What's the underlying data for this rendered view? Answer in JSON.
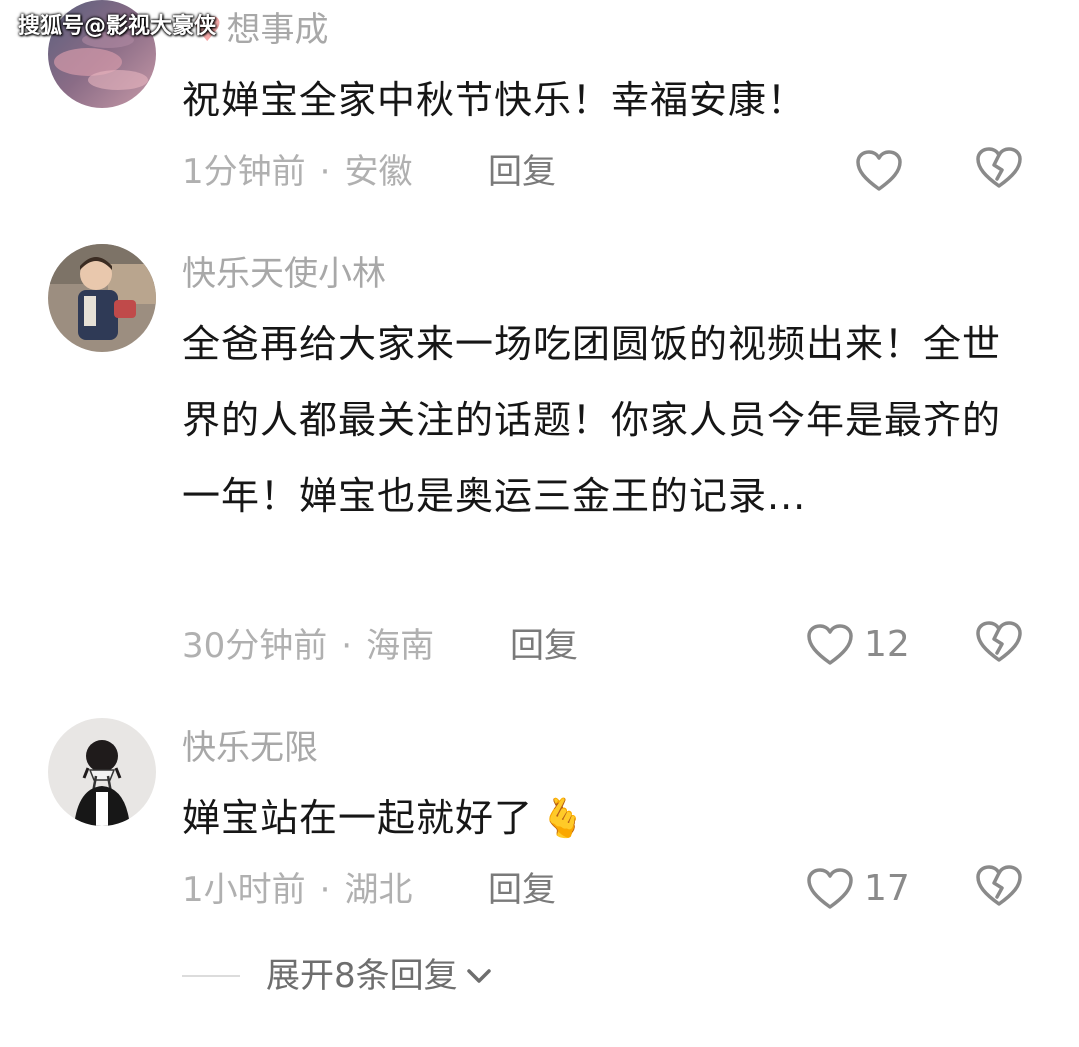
{
  "watermark": "搜狐号@影视大豪侠",
  "comments": [
    {
      "username": "想事成",
      "content": "祝婵宝全家中秋节快乐！幸福安康！",
      "time": "1分钟前",
      "location": "安徽",
      "reply_label": "回复",
      "like_count": "",
      "avatar_icon": "pink-sky-avatar"
    },
    {
      "username": "快乐天使小林",
      "content": "全爸再给大家来一场吃团圆饭的视频出来！全世界的人都最关注的话题！你家人员今年是最齐的一年！婵宝也是奥运三金王的记录...",
      "time": "30分钟前",
      "location": "海南",
      "reply_label": "回复",
      "like_count": "12",
      "avatar_icon": "child-photo-avatar"
    },
    {
      "username": "快乐无限",
      "content": "婵宝站在一起就好了",
      "emoji": "🫰",
      "time": "1小时前",
      "location": "湖北",
      "reply_label": "回复",
      "like_count": "17",
      "avatar_icon": "girl-with-bow-avatar"
    }
  ],
  "separator": "·",
  "expand_label": "展开8条回复",
  "colors": {
    "content": "#161616",
    "muted": "#b0b0b0",
    "username": "#a8a8a8",
    "icon": "#8a8a8a"
  }
}
